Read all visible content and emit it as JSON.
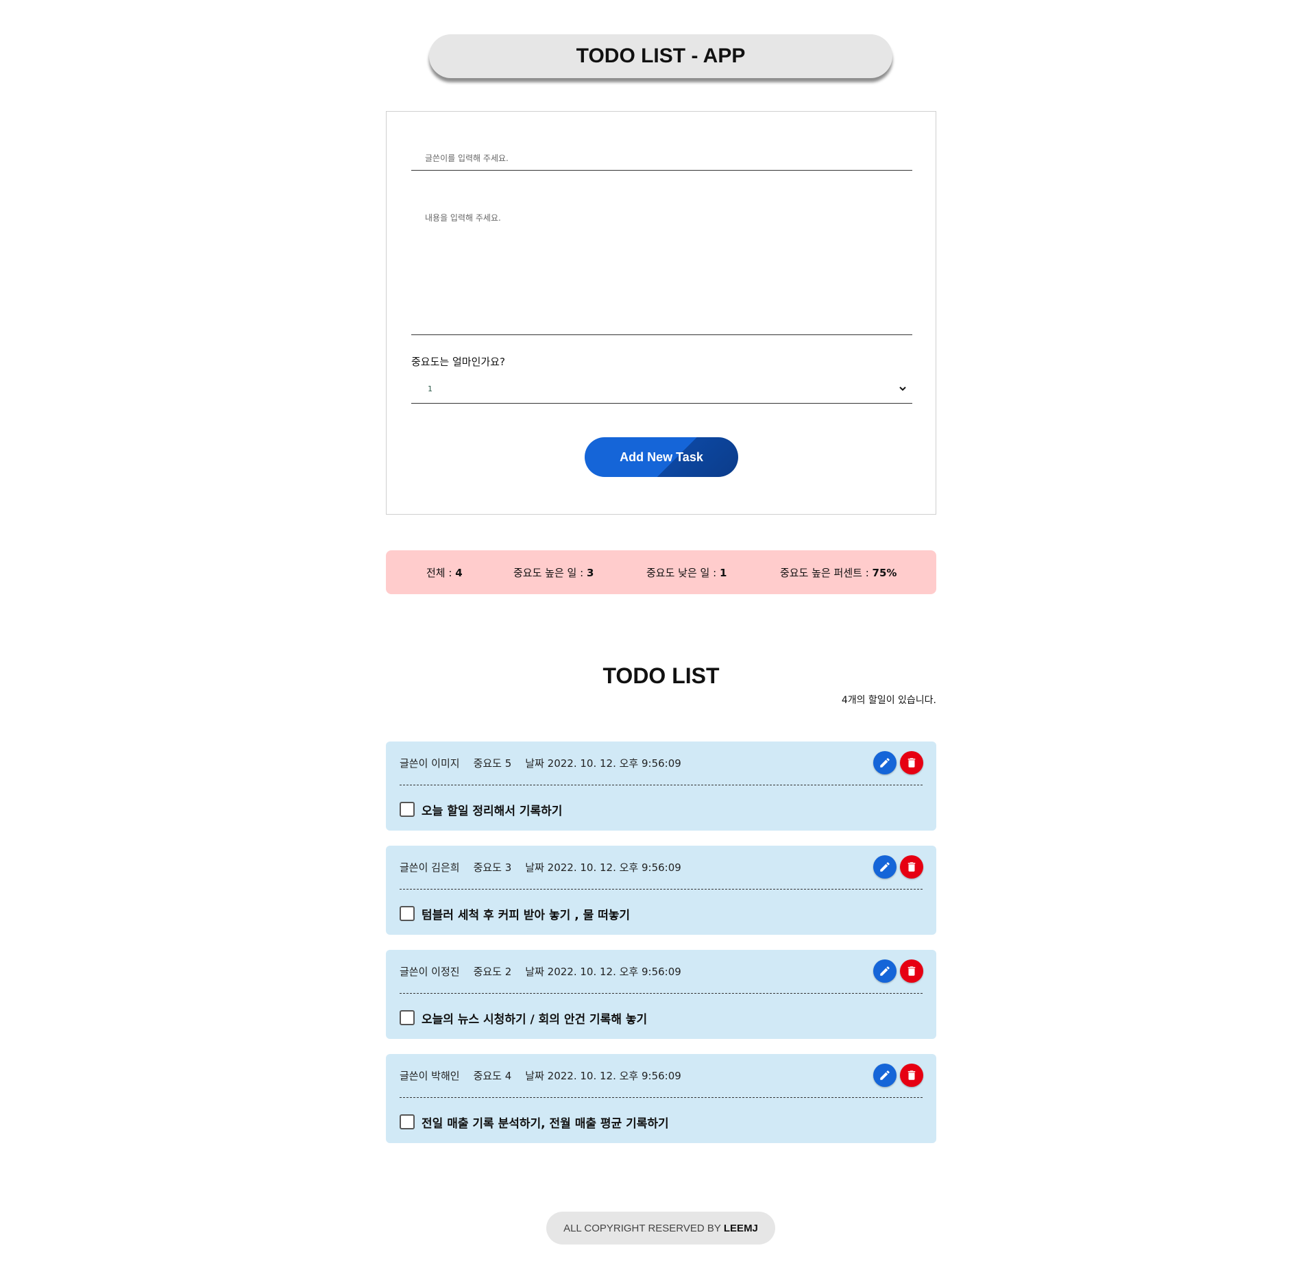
{
  "app": {
    "title": "TODO LIST - APP"
  },
  "form": {
    "writer_placeholder": "글쓴이를 입력해 주세요.",
    "content_placeholder": "내용을 입력해 주세요.",
    "importance_label": "중요도는 얼마인가요?",
    "importance_selected": "1",
    "add_button": "Add New Task"
  },
  "stats": {
    "total_label": "전체 : ",
    "total_value": "4",
    "high_label": "중요도 높은 일 : ",
    "high_value": "3",
    "low_label": "중요도 낮은 일 : ",
    "low_value": "1",
    "percent_label": "중요도 높은 퍼센트 : ",
    "percent_value": "75%"
  },
  "list": {
    "title": "TODO LIST",
    "count_text": "4개의 할일이 있습니다."
  },
  "todos": [
    {
      "writer": "글쓴이 이미지",
      "importance": "중요도 5",
      "date": "날짜 2022. 10. 12. 오후 9:56:09",
      "text": "오늘 할일 정리해서 기록하기",
      "checked": false
    },
    {
      "writer": "글쓴이 김은희",
      "importance": "중요도 3",
      "date": "날짜 2022. 10. 12. 오후 9:56:09",
      "text": "텀블러 세척 후 커피 받아 놓기 , 물 떠놓기",
      "checked": false
    },
    {
      "writer": "글쓴이 이정진",
      "importance": "중요도 2",
      "date": "날짜 2022. 10. 12. 오후 9:56:09",
      "text": "오늘의 뉴스 시청하기 / 회의 안건 기록해 놓기",
      "checked": false
    },
    {
      "writer": "글쓴이 박해인",
      "importance": "중요도 4",
      "date": "날짜 2022. 10. 12. 오후 9:56:09",
      "text": "전일 매출 기록 분석하기, 전월 매출 평균 기록하기",
      "checked": false
    }
  ],
  "footer": {
    "text": "ALL COPYRIGHT RESERVED BY",
    "brand": "LEEMJ"
  },
  "icons": {
    "edit": "pencil-icon",
    "delete": "trash-icon",
    "select": "chevron-down-icon"
  },
  "colors": {
    "primary": "#1565d8",
    "danger": "#e60012",
    "stats_bg": "#ffcccc",
    "card_bg": "#d1e9f6"
  }
}
